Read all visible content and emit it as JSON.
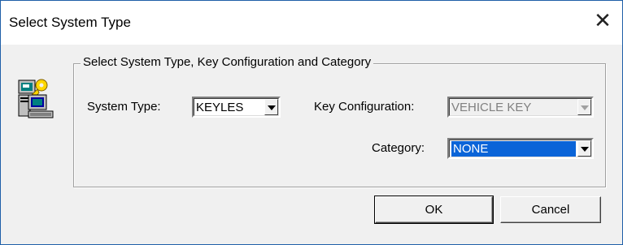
{
  "window": {
    "title": "Select System Type",
    "close_glyph": "✕"
  },
  "group": {
    "legend": "Select System Type, Key Configuration and Category"
  },
  "system_type": {
    "label": "System Type:",
    "value": "KEYLES"
  },
  "key_configuration": {
    "label": "Key Configuration:",
    "value": "VEHICLE KEY",
    "enabled": false
  },
  "category": {
    "label": "Category:",
    "value": "NONE"
  },
  "buttons": {
    "ok": "OK",
    "cancel": "Cancel"
  },
  "icons": {
    "app": "computer-key-icon",
    "dropdown": "chevron-down-icon"
  },
  "colors": {
    "selection": "#0a64d8",
    "border": "#1f5fa8"
  }
}
